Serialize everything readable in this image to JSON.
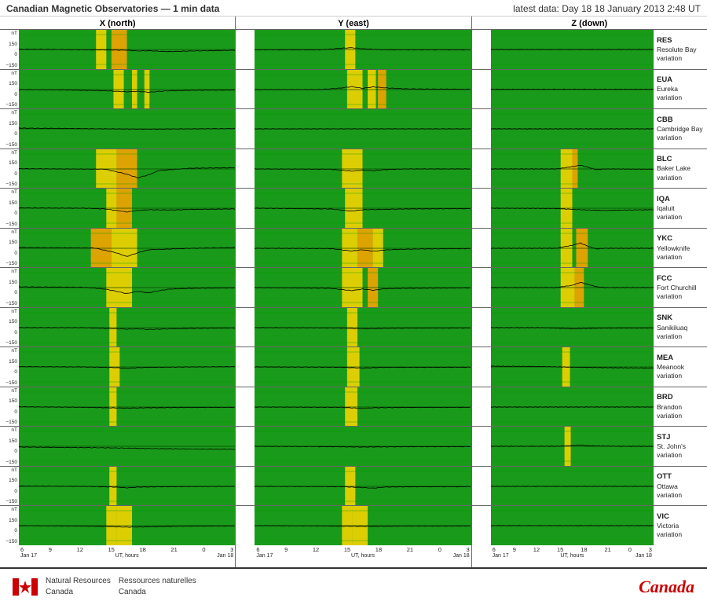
{
  "header": {
    "title": "Canadian Magnetic Observatories — 1 min data",
    "latest": "latest data: Day   18   18 January 2013   2:48 UT"
  },
  "columns": [
    {
      "label": "X (north)"
    },
    {
      "label": "Y (east)"
    },
    {
      "label": "Z (down)"
    }
  ],
  "stations": [
    {
      "code": "RES",
      "name": "Resolute Bay",
      "type": "variation"
    },
    {
      "code": "EUA",
      "name": "Eureka",
      "type": "variation"
    },
    {
      "code": "CBB",
      "name": "Cambridge Bay",
      "type": "variation"
    },
    {
      "code": "BLC",
      "name": "Baker Lake",
      "type": "variation"
    },
    {
      "code": "IQA",
      "name": "Iqaluit",
      "type": "variation"
    },
    {
      "code": "YKC",
      "name": "Yellowknife",
      "type": "variation"
    },
    {
      "code": "FCC",
      "name": "Fort Churchill",
      "type": "variation"
    },
    {
      "code": "SNK",
      "name": "Sanikiluaq",
      "type": "variation"
    },
    {
      "code": "MEA",
      "name": "Meanook",
      "type": "variation"
    },
    {
      "code": "BRD",
      "name": "Brandon",
      "type": "variation"
    },
    {
      "code": "STJ",
      "name": "St. John's",
      "type": "variation"
    },
    {
      "code": "OTT",
      "name": "Ottawa",
      "type": "variation"
    },
    {
      "code": "VIC",
      "name": "Victoria",
      "type": "variation"
    }
  ],
  "xaxis": {
    "ticks": [
      "6",
      "9",
      "12",
      "15",
      "18",
      "21",
      "0",
      "3"
    ],
    "label": "UT, hours",
    "date_left": "Jan 17",
    "date_right": "Jan 18"
  },
  "yticks": {
    "top": "150",
    "mid": "0",
    "bot": "-150"
  },
  "footer": {
    "nrc_line1": "Natural Resources",
    "nrc_line2": "Canada",
    "nrc_fr_line1": "Ressources naturelles",
    "nrc_fr_line2": "Canada",
    "canada_wordmark": "Canadä"
  }
}
